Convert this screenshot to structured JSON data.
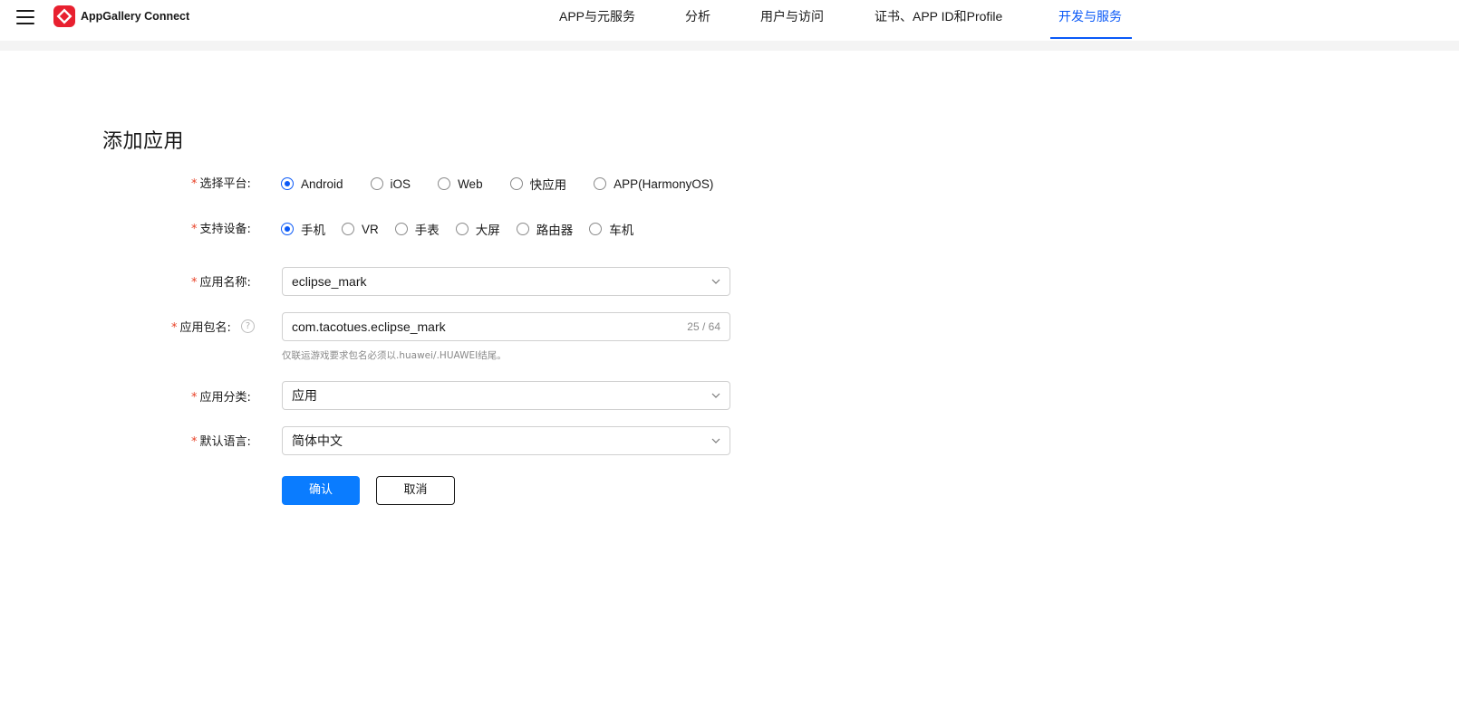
{
  "header": {
    "logo_text": "AppGallery Connect",
    "nav": [
      {
        "label": "APP与元服务"
      },
      {
        "label": "分析"
      },
      {
        "label": "用户与访问"
      },
      {
        "label": "证书、APP ID和Profile"
      },
      {
        "label": "开发与服务",
        "active": true
      }
    ]
  },
  "form": {
    "title": "添加应用",
    "required_mark": "*",
    "platform": {
      "label": "选择平台:",
      "options": [
        "Android",
        "iOS",
        "Web",
        "快应用",
        "APP(HarmonyOS)"
      ],
      "selected": "Android"
    },
    "device": {
      "label": "支持设备:",
      "options": [
        "手机",
        "VR",
        "手表",
        "大屏",
        "路由器",
        "车机"
      ],
      "selected": "手机"
    },
    "app_name": {
      "label": "应用名称:",
      "value": "eclipse_mark"
    },
    "package_name": {
      "label": "应用包名:",
      "help_glyph": "?",
      "value": "com.tacotues.eclipse_mark",
      "counter": "25 / 64",
      "hint": "仅联运游戏要求包名必须以.huawei/.HUAWEI结尾。"
    },
    "category": {
      "label": "应用分类:",
      "value": "应用"
    },
    "language": {
      "label": "默认语言:",
      "value": "简体中文"
    },
    "confirm_label": "确认",
    "cancel_label": "取消"
  },
  "colors": {
    "accent": "#0a59f7",
    "primary_button": "#0a7cff",
    "required": "#e84026",
    "logo": "#e8202f"
  },
  "icons": [
    "menu-icon",
    "appgallery-logo-icon",
    "help-icon",
    "chevron-down-icon"
  ]
}
